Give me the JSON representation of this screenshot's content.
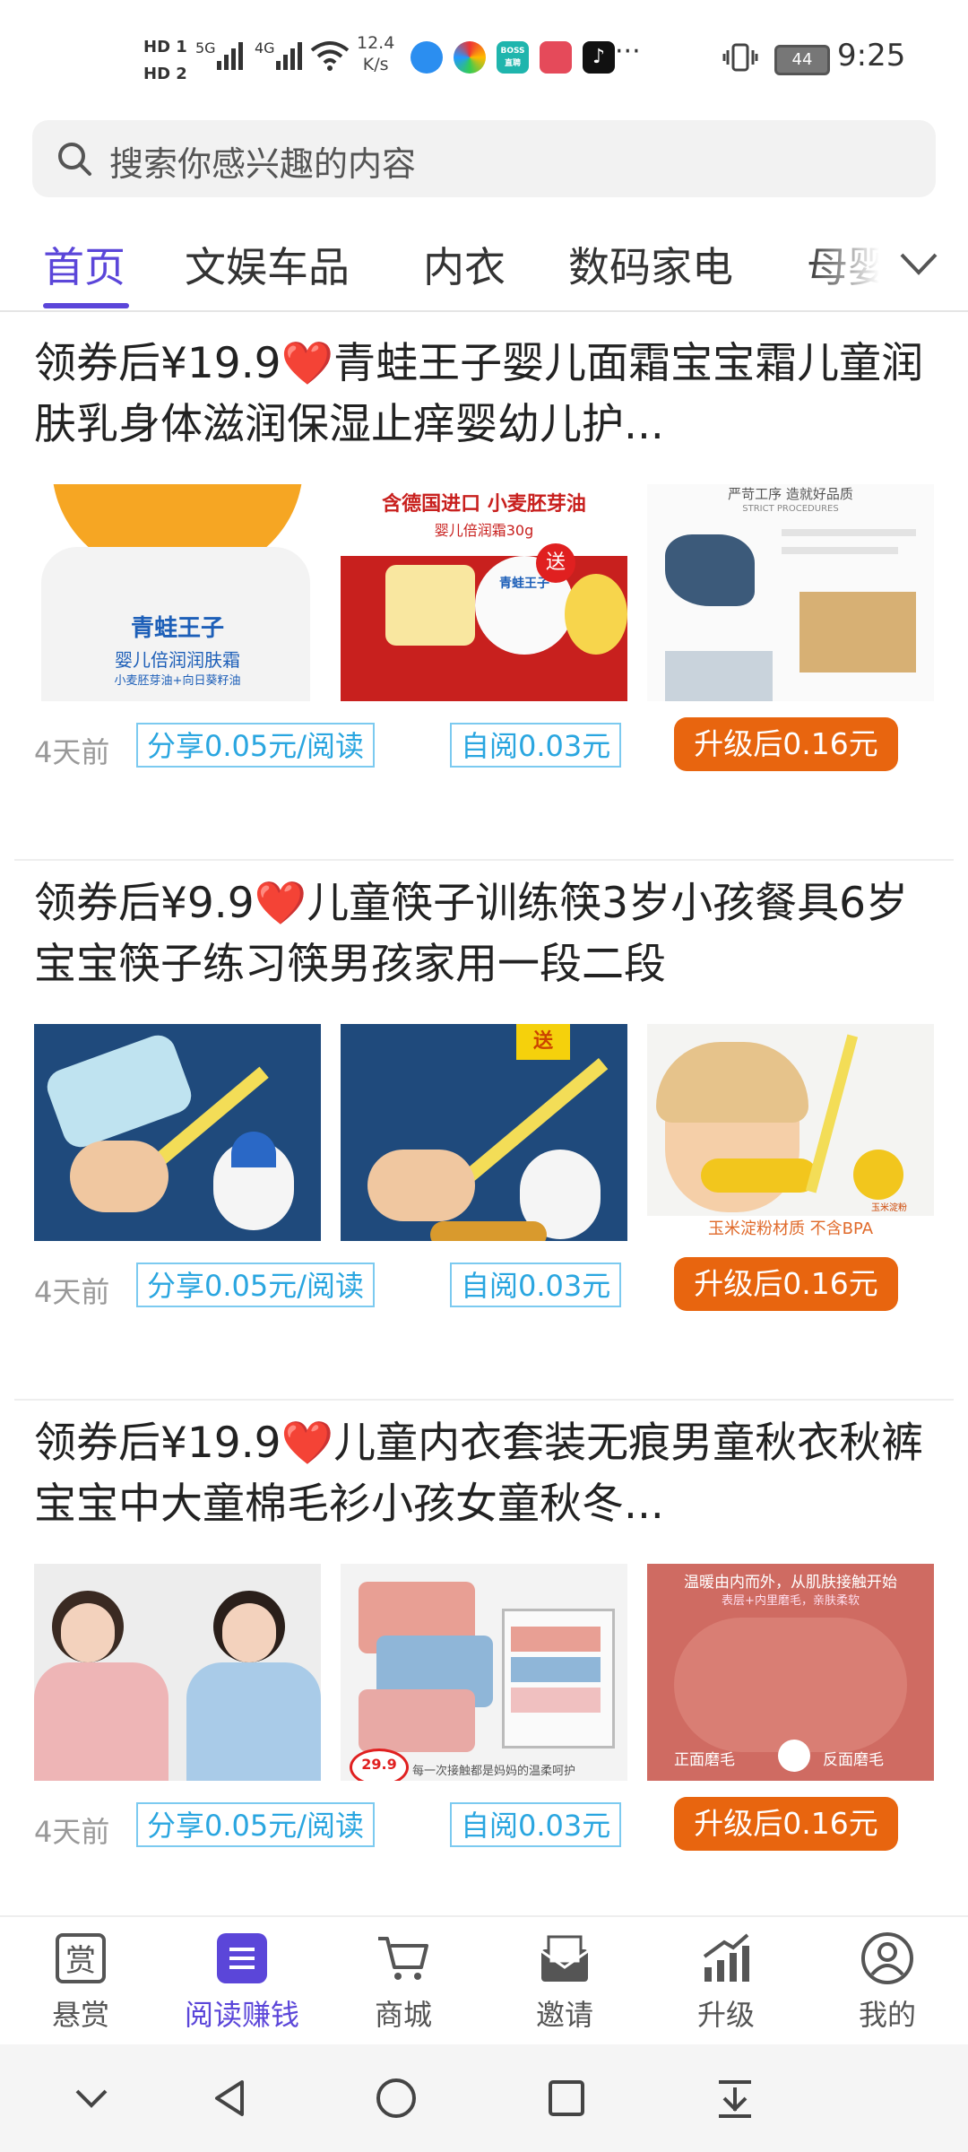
{
  "status_bar": {
    "hd1": "HD 1",
    "hd2": "HD 2",
    "sig1": "5G",
    "sig2": "4G",
    "speed_value": "12.4",
    "speed_unit": "K/s",
    "app_icons": [
      "browser-icon",
      "colorful-app-icon",
      "boss-app-icon",
      "book-app-icon",
      "tiktok-icon"
    ],
    "boss_label": "BOSS直聘",
    "battery": "44",
    "time": "9:25"
  },
  "search": {
    "placeholder": "搜索你感兴趣的内容"
  },
  "tabs": [
    {
      "label": "首页",
      "active": true
    },
    {
      "label": "文娱车品",
      "active": false
    },
    {
      "label": "内衣",
      "active": false
    },
    {
      "label": "数码家电",
      "active": false
    },
    {
      "label": "母婴",
      "active": false
    }
  ],
  "items": [
    {
      "title_prefix": "领券后¥19.9",
      "heart": "❤️",
      "title_rest": "青蛙王子婴儿面霜宝宝霜儿童润肤乳身体滋润保湿止痒婴幼儿护...",
      "img1_brand": "青蛙王子",
      "img1_product": "婴儿倍润润肤霜",
      "img1_sub": "小麦胚芽油+向日葵籽油",
      "img2_banner": "含德国进口 小麦胚芽油",
      "img2_sub": "婴儿倍润霜30g",
      "img2_gift": "送",
      "img2_brand": "青蛙王子",
      "img3_title": "严苛工序 造就好品质",
      "img3_sub": "STRICT PROCEDURES",
      "time": "4天前",
      "share": "分享0.05元/阅读",
      "self_read": "自阅0.03元",
      "upgrade": "升级后0.16元"
    },
    {
      "title_prefix": "领券后¥9.9",
      "heart": "❤️",
      "title_rest": "儿童筷子训练筷3岁小孩餐具6岁宝宝筷子练习筷男孩家用一段二段",
      "img2_badge": "送",
      "img3_caption": "玉米淀粉材质 不含BPA",
      "img3_corn": "玉米淀粉",
      "time": "4天前",
      "share": "分享0.05元/阅读",
      "self_read": "自阅0.03元",
      "upgrade": "升级后0.16元"
    },
    {
      "title_prefix": "领券后¥19.9",
      "heart": "❤️",
      "title_rest": "儿童内衣套装无痕男童秋衣秋裤宝宝中大童棉毛衫小孩女童秋冬...",
      "img2_price": "29.9",
      "img2_caption": "每一次接触都是妈妈的温柔呵护",
      "img3_title": "温暖由内而外，从肌肤接触开始",
      "img3_sub": "表层+内里磨毛，亲肤柔软",
      "img3_left": "正面磨毛",
      "img3_right": "反面磨毛",
      "time": "4天前",
      "share": "分享0.05元/阅读",
      "self_read": "自阅0.03元",
      "upgrade": "升级后0.16元"
    }
  ],
  "bottom_nav": [
    {
      "label": "悬赏",
      "icon": "reward-icon",
      "active": false,
      "glyph": "赏"
    },
    {
      "label": "阅读赚钱",
      "icon": "read-earn-icon",
      "active": true
    },
    {
      "label": "商城",
      "icon": "cart-icon",
      "active": false
    },
    {
      "label": "邀请",
      "icon": "invite-icon",
      "active": false
    },
    {
      "label": "升级",
      "icon": "upgrade-icon",
      "active": false
    },
    {
      "label": "我的",
      "icon": "profile-icon",
      "active": false
    }
  ],
  "colors": {
    "accent": "#5b46d9",
    "orange": "#e8650f",
    "tag_blue": "#2aa6e0"
  }
}
